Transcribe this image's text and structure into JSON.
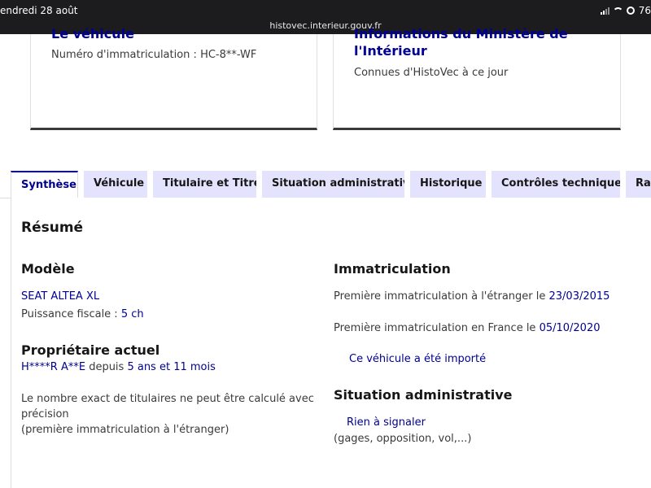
{
  "statusbar": {
    "date": "endredi 28 août",
    "url": "histovec.interieur.gouv.fr",
    "battery": "76"
  },
  "card_vehicle": {
    "title": "Le véhicule",
    "plate_label": "Numéro d'immatriculation : ",
    "plate_value": "HC-8**-WF"
  },
  "card_ministry": {
    "title_line1": "Informations du Ministère de",
    "title_line2": "l'Intérieur",
    "subtitle": "Connues d'HistoVec à ce jour"
  },
  "tabs": [
    "Synthèse",
    "Véhicule",
    "Titulaire et Titre",
    "Situation administrative",
    "Historique",
    "Contrôles techniques",
    "Rap"
  ],
  "summary": {
    "heading": "Résumé",
    "model": {
      "heading": "Modèle",
      "name": "SEAT ALTEA XL",
      "power_label": "Puissance fiscale : ",
      "power_value": "5 ch"
    },
    "owner": {
      "heading": "Propriétaire actuel",
      "name": "H****R A**E",
      "since_label": " depuis ",
      "since_value": "5 ans et 11 mois",
      "note_line1": "Le nombre exact de titulaires ne peut être calculé avec",
      "note_line2": "précision",
      "note_line3": "(première immatriculation à l'étranger)"
    },
    "registration": {
      "heading": "Immatriculation",
      "foreign_label": "Première immatriculation à l'étranger le ",
      "foreign_date": "23/03/2015",
      "france_label": "Première immatriculation en France le ",
      "france_date": "05/10/2020",
      "imported": "Ce véhicule a été importé"
    },
    "admin": {
      "heading": "Situation administrative",
      "status": "Rien à signaler",
      "detail": "(gages, opposition, vol,...)"
    }
  }
}
